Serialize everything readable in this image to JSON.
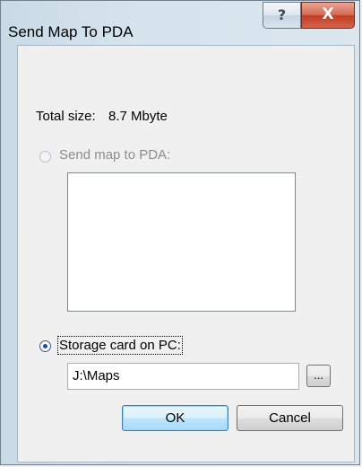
{
  "window": {
    "title": "Send Map To PDA",
    "help_glyph": "?",
    "close_glyph": "X"
  },
  "info": {
    "total_label": "Total size:",
    "total_value": "8.7 Mbyte"
  },
  "options": {
    "send_to_pda": {
      "label": "Send map to PDA:",
      "selected": false,
      "enabled": false
    },
    "storage_card": {
      "label": "Storage card on PC:",
      "selected": true,
      "enabled": true
    }
  },
  "path": {
    "value": "J:\\Maps",
    "browse_label": "..."
  },
  "buttons": {
    "ok_label": "OK",
    "cancel_label": "Cancel"
  },
  "icons": {
    "help": "help-icon",
    "close": "close-icon"
  }
}
